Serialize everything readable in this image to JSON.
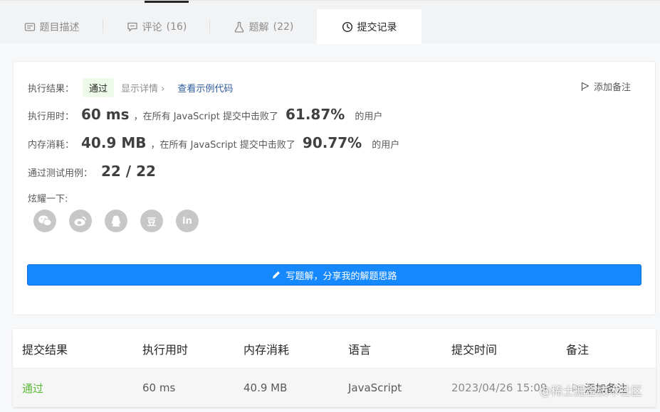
{
  "tabs": [
    {
      "label": "题目描述",
      "count": "",
      "icon": "description-icon"
    },
    {
      "label": "评论",
      "count": "(16)",
      "icon": "comment-icon"
    },
    {
      "label": "题解",
      "count": "(22)",
      "icon": "flask-icon"
    },
    {
      "label": "提交记录",
      "count": "",
      "icon": "clock-icon",
      "active": true
    }
  ],
  "result": {
    "status_label": "执行结果：",
    "status_value": "通过",
    "details_link": "显示详情 ›",
    "example_link": "查看示例代码",
    "add_note": "添加备注",
    "runtime_label": "执行用时：",
    "runtime_value": "60 ms",
    "runtime_text": "，在所有 JavaScript 提交中击败了",
    "runtime_percent": "61.87%",
    "runtime_suffix": "的用户",
    "memory_label": "内存消耗：",
    "memory_value": "40.9 MB",
    "memory_text": "，在所有 JavaScript 提交中击败了",
    "memory_percent": "90.77%",
    "memory_suffix": "的用户",
    "tests_label": "通过测试用例：",
    "tests_value": "22 / 22",
    "share_label": "炫耀一下:",
    "share_icons": [
      "wechat-icon",
      "weibo-icon",
      "qq-icon",
      "douban-icon",
      "linkedin-icon"
    ],
    "douban_glyph": "豆",
    "linkedin_glyph": "in",
    "write_button": "写题解，分享我的解题思路"
  },
  "table": {
    "headers": [
      "提交结果",
      "执行用时",
      "内存消耗",
      "语言",
      "提交时间",
      "备注"
    ],
    "rows": [
      {
        "status": "通过",
        "runtime": "60 ms",
        "memory": "40.9 MB",
        "language": "JavaScript",
        "time": "2023/04/26 15:09",
        "note": "添加备注"
      }
    ]
  },
  "watermark": "@稀土掘金技术社区",
  "colors": {
    "accent_blue": "#1789ff",
    "pass_green": "#5bb939",
    "link_blue": "#2e5a9c"
  }
}
